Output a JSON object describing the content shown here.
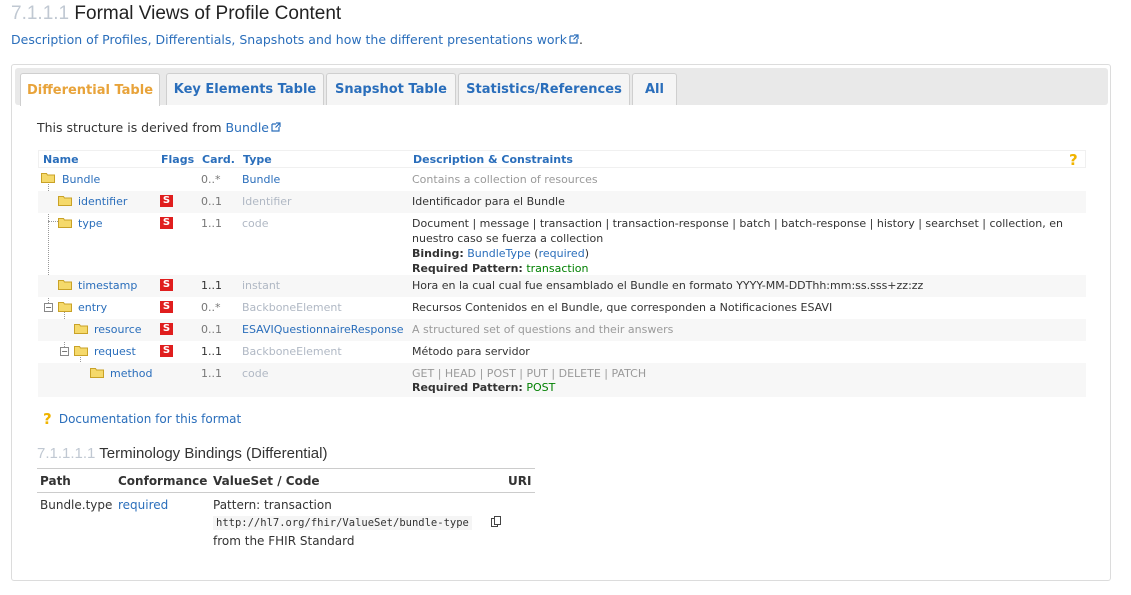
{
  "header": {
    "section_number": "7.1.1.1",
    "title": "Formal Views of Profile Content",
    "description_link": "Description of Profiles, Differentials, Snapshots and how the different presentations work",
    "description_suffix": "."
  },
  "tabs": [
    {
      "label": "Differential Table",
      "active": true
    },
    {
      "label": "Key Elements Table",
      "active": false
    },
    {
      "label": "Snapshot Table",
      "active": false
    },
    {
      "label": "Statistics/References",
      "active": false
    },
    {
      "label": "All",
      "active": false
    }
  ],
  "derived": {
    "prefix": "This structure is derived from ",
    "link": "Bundle"
  },
  "table": {
    "headers": {
      "name": "Name",
      "flags": "Flags",
      "card": "Card.",
      "type": "Type",
      "desc": "Description & Constraints"
    },
    "rows": [
      {
        "name": "Bundle",
        "flag": "",
        "card": "0..*",
        "type": "Bundle",
        "desc": "Contains a collection of resources"
      },
      {
        "name": "identifier",
        "flag": "S",
        "card": "0..1",
        "type": "Identifier",
        "desc": "Identificador para el Bundle"
      },
      {
        "name": "type",
        "flag": "S",
        "card": "1..1",
        "type": "code",
        "desc": "Document | message | transaction | transaction-response | batch | batch-response | history | searchset | collection, en",
        "desc2": "nuestro caso se fuerza a collection",
        "binding_label": "Binding:",
        "binding_link": "BundleType",
        "binding_strength": "required",
        "pattern_label": "Required Pattern:",
        "pattern_value": "transaction"
      },
      {
        "name": "timestamp",
        "flag": "S",
        "card": "1..1",
        "type": "instant",
        "desc": "Hora en la cual cual fue ensamblado el Bundle en formato YYYY-MM-DDThh:mm:ss.sss+zz:zz"
      },
      {
        "name": "entry",
        "flag": "S",
        "card": "0..*",
        "type": "BackboneElement",
        "desc": "Recursos Contenidos en el Bundle, que corresponden a Notificaciones ESAVI"
      },
      {
        "name": "resource",
        "flag": "S",
        "card": "0..1",
        "type": "ESAVIQuestionnaireResponse",
        "desc": "A structured set of questions and their answers"
      },
      {
        "name": "request",
        "flag": "S",
        "card": "1..1",
        "type": "BackboneElement",
        "desc": "Método para servidor"
      },
      {
        "name": "method",
        "flag": "",
        "card": "1..1",
        "type": "code",
        "desc": "GET | HEAD | POST | PUT | DELETE | PATCH",
        "pattern_label": "Required Pattern:",
        "pattern_value": "POST"
      }
    ]
  },
  "docs_link": "Documentation for this format",
  "bindings": {
    "section_number": "7.1.1.1.1",
    "title": "Terminology Bindings (Differential)",
    "headers": {
      "path": "Path",
      "conformance": "Conformance",
      "valueset": "ValueSet / Code",
      "uri": "URI"
    },
    "row": {
      "path": "Bundle.type",
      "conformance": "required",
      "pattern": "Pattern: transaction",
      "code": "http://hl7.org/fhir/ValueSet/bundle-type",
      "source": "from the FHIR Standard"
    }
  },
  "colors": {
    "link": "#2a6ebb",
    "active_tab": "#e8a33a",
    "flag": "#e01e1e",
    "pattern": "#008000"
  }
}
